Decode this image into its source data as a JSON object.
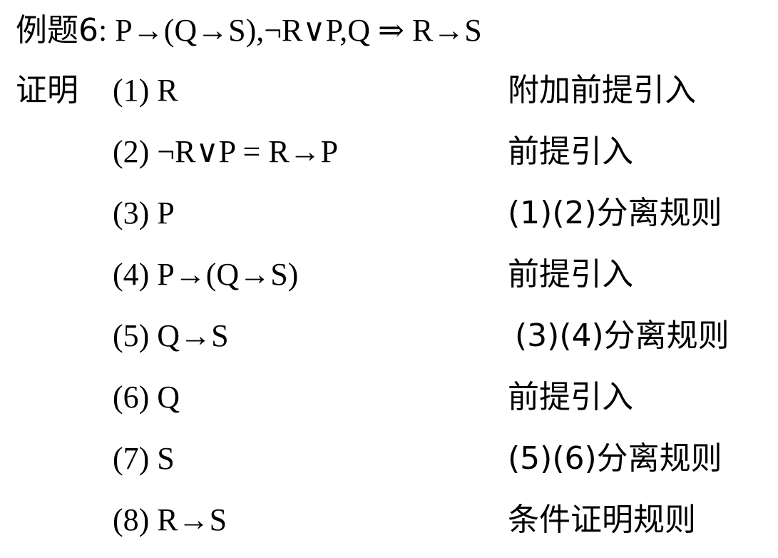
{
  "title": {
    "label": "例题6",
    "statement": ": P→(Q→S),¬R∨P,Q ⇒ R→S"
  },
  "proof_label": "证明",
  "steps": [
    {
      "formula": "(1) R",
      "reason": "附加前提引入"
    },
    {
      "formula": "(2) ¬R∨P  = R→P",
      "reason": "前提引入"
    },
    {
      "formula": "(3) P",
      "reason": "(1)(2)分离规则"
    },
    {
      "formula": "(4) P→(Q→S)",
      "reason": "前提引入"
    },
    {
      "formula": "(5) Q→S",
      "reason": "(3)(4)分离规则"
    },
    {
      "formula": "(6) Q",
      "reason": "前提引入"
    },
    {
      "formula": "(7) S",
      "reason": "(5)(6)分离规则"
    },
    {
      "formula": "(8) R→S",
      "reason": "条件证明规则"
    }
  ]
}
